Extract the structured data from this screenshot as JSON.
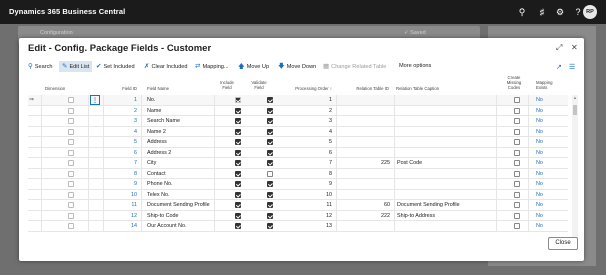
{
  "app": {
    "title": "Dynamics 365 Business Central",
    "user_initials": "RP"
  },
  "background": {
    "crumb": "Configuration",
    "save_status": "✓ Saved"
  },
  "dialog": {
    "title": "Edit - Config. Package Fields - Customer"
  },
  "toolbar": {
    "search": "Search",
    "edit_list": "Edit List",
    "set_included": "Set Included",
    "clear_included": "Clear Included",
    "mapping": "Mapping...",
    "move_up": "Move Up",
    "move_down": "Move Down",
    "change_related_table": "Change Related Table",
    "more_options": "More options"
  },
  "columns": {
    "dimension": "Dimension",
    "field_id": "Field ID",
    "field_name": "Field Name",
    "include_field": [
      "Include",
      "Field"
    ],
    "validate_field": [
      "Validate",
      "Field"
    ],
    "processing_order": "Processing Order ↑",
    "relation_table_id": "Relation Table ID",
    "relation_table_caption": "Relation Table Caption",
    "create_missing_codes": [
      "Create",
      "Missing",
      "Codes"
    ],
    "mapping_exists": [
      "Mapping",
      "Exists"
    ]
  },
  "rows": [
    {
      "field_id": "1",
      "field_name": "No.",
      "include": true,
      "validate": true,
      "order": "1",
      "rel_id": "",
      "rel_caption": "",
      "mapping": "No"
    },
    {
      "field_id": "2",
      "field_name": "Name",
      "include": true,
      "validate": true,
      "order": "2",
      "rel_id": "",
      "rel_caption": "",
      "mapping": "No"
    },
    {
      "field_id": "3",
      "field_name": "Search Name",
      "include": true,
      "validate": true,
      "order": "3",
      "rel_id": "",
      "rel_caption": "",
      "mapping": "No"
    },
    {
      "field_id": "4",
      "field_name": "Name 2",
      "include": true,
      "validate": true,
      "order": "4",
      "rel_id": "",
      "rel_caption": "",
      "mapping": "No"
    },
    {
      "field_id": "5",
      "field_name": "Address",
      "include": true,
      "validate": true,
      "order": "5",
      "rel_id": "",
      "rel_caption": "",
      "mapping": "No"
    },
    {
      "field_id": "6",
      "field_name": "Address 2",
      "include": true,
      "validate": true,
      "order": "6",
      "rel_id": "",
      "rel_caption": "",
      "mapping": "No"
    },
    {
      "field_id": "7",
      "field_name": "City",
      "include": true,
      "validate": true,
      "order": "7",
      "rel_id": "225",
      "rel_caption": "Post Code",
      "mapping": "No"
    },
    {
      "field_id": "8",
      "field_name": "Contact",
      "include": true,
      "validate": false,
      "order": "8",
      "rel_id": "",
      "rel_caption": "",
      "mapping": "No"
    },
    {
      "field_id": "9",
      "field_name": "Phone No.",
      "include": true,
      "validate": true,
      "order": "9",
      "rel_id": "",
      "rel_caption": "",
      "mapping": "No"
    },
    {
      "field_id": "10",
      "field_name": "Telex No.",
      "include": true,
      "validate": true,
      "order": "10",
      "rel_id": "",
      "rel_caption": "",
      "mapping": "No"
    },
    {
      "field_id": "11",
      "field_name": "Document Sending Profile",
      "include": true,
      "validate": true,
      "order": "11",
      "rel_id": "60",
      "rel_caption": "Document Sending Profile",
      "mapping": "No"
    },
    {
      "field_id": "12",
      "field_name": "Ship-to Code",
      "include": true,
      "validate": true,
      "order": "12",
      "rel_id": "222",
      "rel_caption": "Ship-to Address",
      "mapping": "No"
    },
    {
      "field_id": "14",
      "field_name": "Our Account No.",
      "include": true,
      "validate": true,
      "order": "13",
      "rel_id": "",
      "rel_caption": "",
      "mapping": "No"
    }
  ],
  "buttons": {
    "close": "Close"
  }
}
